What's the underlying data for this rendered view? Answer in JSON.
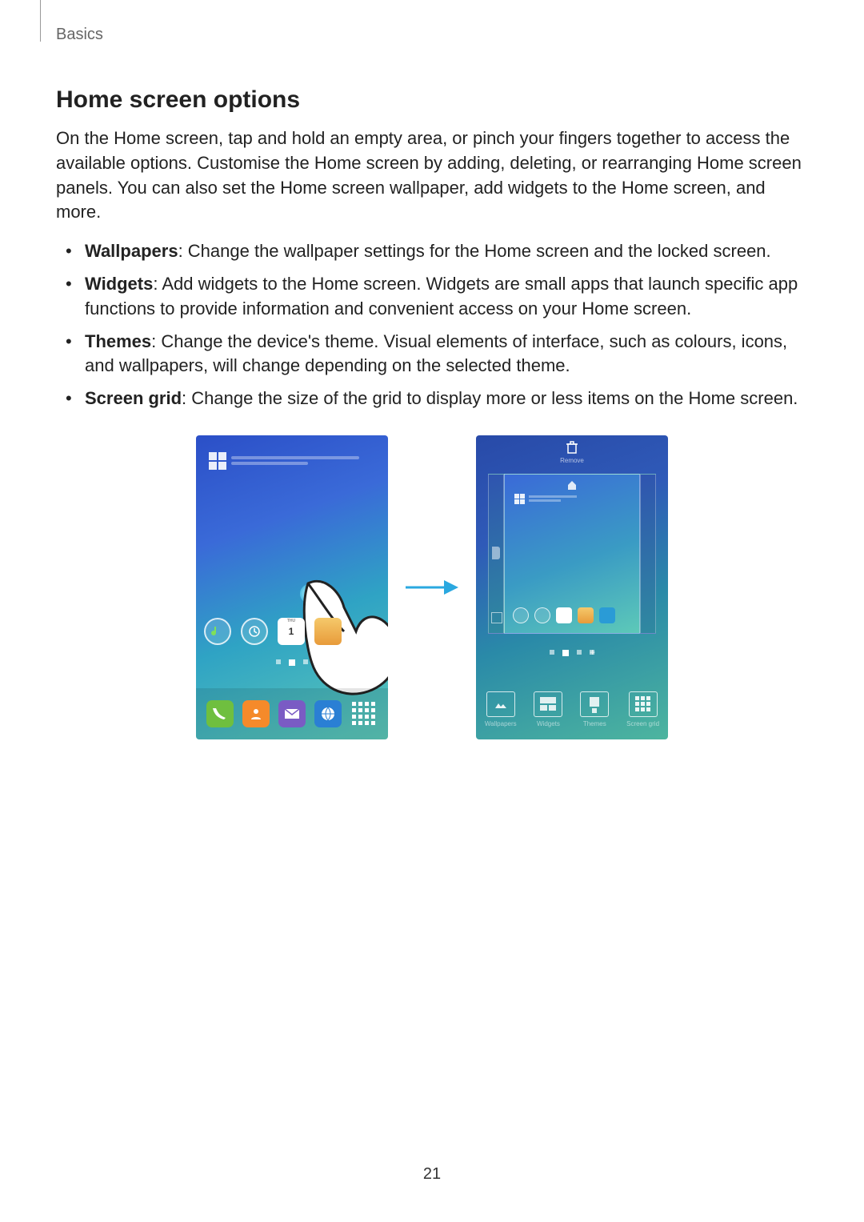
{
  "breadcrumb": "Basics",
  "heading": "Home screen options",
  "intro": "On the Home screen, tap and hold an empty area, or pinch your fingers together to access the available options. Customise the Home screen by adding, deleting, or rearranging Home screen panels. You can also set the Home screen wallpaper, add widgets to the Home screen, and more.",
  "bullets": [
    {
      "label": "Wallpapers",
      "text": ": Change the wallpaper settings for the Home screen and the locked screen."
    },
    {
      "label": "Widgets",
      "text": ": Add widgets to the Home screen. Widgets are small apps that launch specific app functions to provide information and convenient access on your Home screen."
    },
    {
      "label": "Themes",
      "text": ": Change the device's theme. Visual elements of interface, such as colours, icons, and wallpapers, will change depending on the selected theme."
    },
    {
      "label": "Screen grid",
      "text": ": Change the size of the grid to display more or less items on the Home screen."
    }
  ],
  "figure": {
    "remove_label": "Remove",
    "calendar_day": "1",
    "options": {
      "wallpapers": "Wallpapers",
      "widgets": "Widgets",
      "themes": "Themes",
      "screen_grid": "Screen grid"
    }
  },
  "page_number": "21"
}
